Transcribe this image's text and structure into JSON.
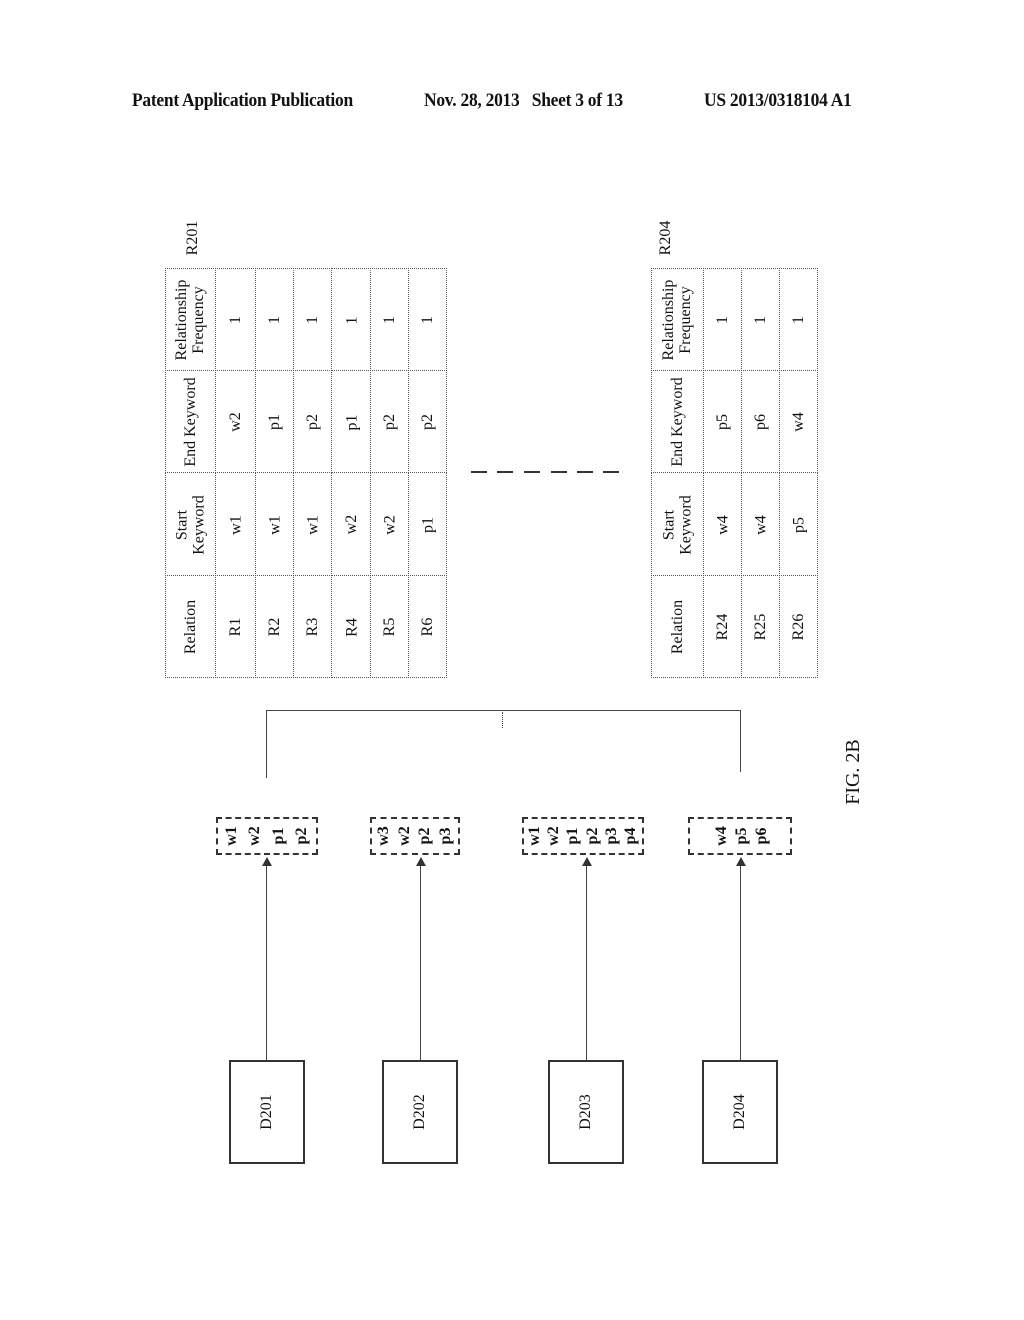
{
  "header": {
    "publication": "Patent Application Publication",
    "date_sheet": "Nov. 28, 2013   Sheet 3 of 13",
    "number": "US 2013/0318104 A1"
  },
  "figure_label": "FIG. 2B",
  "tables": [
    {
      "label": "R201",
      "columns": [
        "Relation",
        "Start Keyword",
        "End Keyword",
        "Relationship Frequency"
      ],
      "rows": [
        [
          "R1",
          "w1",
          "w2",
          "1"
        ],
        [
          "R2",
          "w1",
          "p1",
          "1"
        ],
        [
          "R3",
          "w1",
          "p2",
          "1"
        ],
        [
          "R4",
          "w2",
          "p1",
          "1"
        ],
        [
          "R5",
          "w2",
          "p2",
          "1"
        ],
        [
          "R6",
          "p1",
          "p2",
          "1"
        ]
      ]
    },
    {
      "label": "R204",
      "columns": [
        "Relation",
        "Start Keyword",
        "End Keyword",
        "Relationship Frequency"
      ],
      "rows": [
        [
          "R24",
          "w4",
          "p5",
          "1"
        ],
        [
          "R25",
          "w4",
          "p6",
          "1"
        ],
        [
          "R26",
          "p5",
          "w4",
          "1"
        ]
      ]
    }
  ],
  "documents": [
    {
      "label": "D201",
      "keywords": [
        "w1",
        "w2",
        "p1",
        "p2"
      ]
    },
    {
      "label": "D202",
      "keywords": [
        "w3",
        "w2",
        "p2",
        "p3"
      ]
    },
    {
      "label": "D203",
      "keywords": [
        "w1",
        "w2",
        "p1",
        "p2",
        "p3",
        "p4"
      ]
    },
    {
      "label": "D204",
      "keywords": [
        "w4",
        "p5",
        "p6"
      ]
    }
  ]
}
